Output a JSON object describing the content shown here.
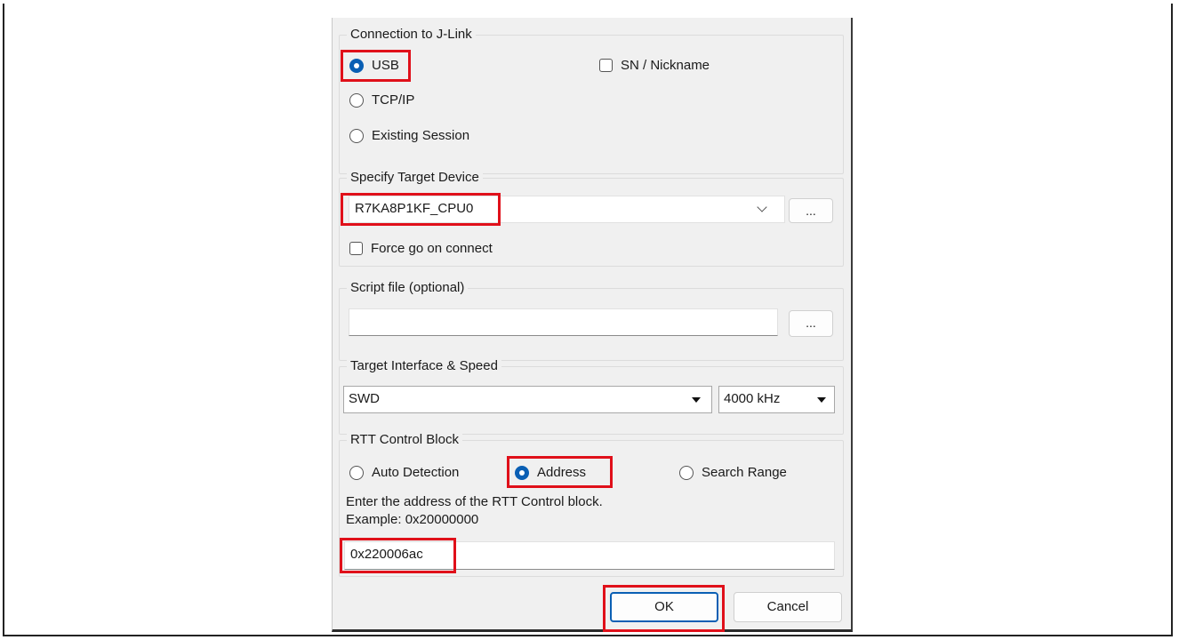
{
  "connection": {
    "title": "Connection to J-Link",
    "usb_label": "USB",
    "tcpip_label": "TCP/IP",
    "existing_label": "Existing Session",
    "sn_label": "SN / Nickname"
  },
  "target_device": {
    "title": "Specify Target Device",
    "value": "R7KA8P1KF_CPU0",
    "browse_label": "...",
    "force_go_label": "Force go on connect"
  },
  "script_file": {
    "title": "Script file (optional)",
    "value": "",
    "browse_label": "..."
  },
  "interface": {
    "title": "Target Interface & Speed",
    "interface_value": "SWD",
    "speed_value": "4000 kHz"
  },
  "rtt": {
    "title": "RTT Control Block",
    "auto_label": "Auto Detection",
    "address_label": "Address",
    "search_label": "Search Range",
    "hint_line1": "Enter the address of the RTT Control block.",
    "hint_line2": "Example: 0x20000000",
    "address_value": "0x220006ac"
  },
  "buttons": {
    "ok_label": "OK",
    "cancel_label": "Cancel"
  },
  "colors": {
    "highlight": "#e0101a",
    "accent": "#0a5fb4"
  }
}
